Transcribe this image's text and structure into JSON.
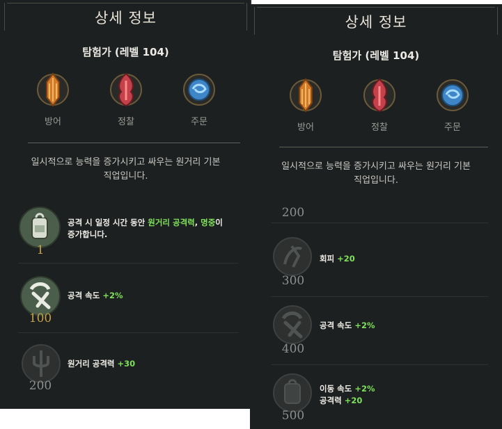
{
  "left": {
    "title": "상세 정보",
    "class_name": "탐험가 (레벨 104)",
    "stats": [
      {
        "label": "방어",
        "icon": "defense-emblem-icon",
        "color": "#d07a2a"
      },
      {
        "label": "정찰",
        "icon": "scout-emblem-icon",
        "color": "#c2414a"
      },
      {
        "label": "주문",
        "icon": "spell-emblem-icon",
        "color": "#3f86c8"
      }
    ],
    "description_line1": "일시적으로 능력을 증가시키고 싸우는 원거리 기본",
    "description_line2": "직업입니다.",
    "perks": [
      {
        "level": "1",
        "icon": "backpack-icon",
        "pre": "공격 시 일정 시간 동안 ",
        "hl1": "원거리 공격력",
        "mid": ", ",
        "hl2": "명중",
        "post": "이",
        "line2": "증가합니다."
      },
      {
        "level": "100",
        "icon": "crossed-blades-icon",
        "text": "공격 속도 ",
        "bonus": "+2%"
      },
      {
        "level": "200",
        "icon": "trident-icon",
        "text": "원거리 공격력 ",
        "bonus": "+30"
      }
    ]
  },
  "right": {
    "title": "상세 정보",
    "class_name": "탐험가 (레벨 104)",
    "stats": [
      {
        "label": "방어",
        "icon": "defense-emblem-icon"
      },
      {
        "label": "정찰",
        "icon": "scout-emblem-icon"
      },
      {
        "label": "주문",
        "icon": "spell-emblem-icon"
      }
    ],
    "description_line1": "일시적으로 능력을 증가시키고 싸우는 원거리 기본",
    "description_line2": "직업입니다.",
    "perks": [
      {
        "level": "200"
      },
      {
        "level": "300",
        "icon": "dodge-figure-icon",
        "text": "회피 ",
        "bonus": "+20"
      },
      {
        "level": "400",
        "icon": "crossed-blades-icon",
        "text": "공격 속도 ",
        "bonus": "+2%"
      },
      {
        "level": "500",
        "icon": "backpack-icon",
        "text": "이동 속도 ",
        "bonus": "+2%",
        "text2": "공격력 ",
        "bonus2": "+20"
      }
    ]
  },
  "colors": {
    "panel_bg": "#1d2020",
    "accent_green": "#7ee05a",
    "level_gold": "#c6a24a",
    "level_gray": "#8e9090"
  }
}
